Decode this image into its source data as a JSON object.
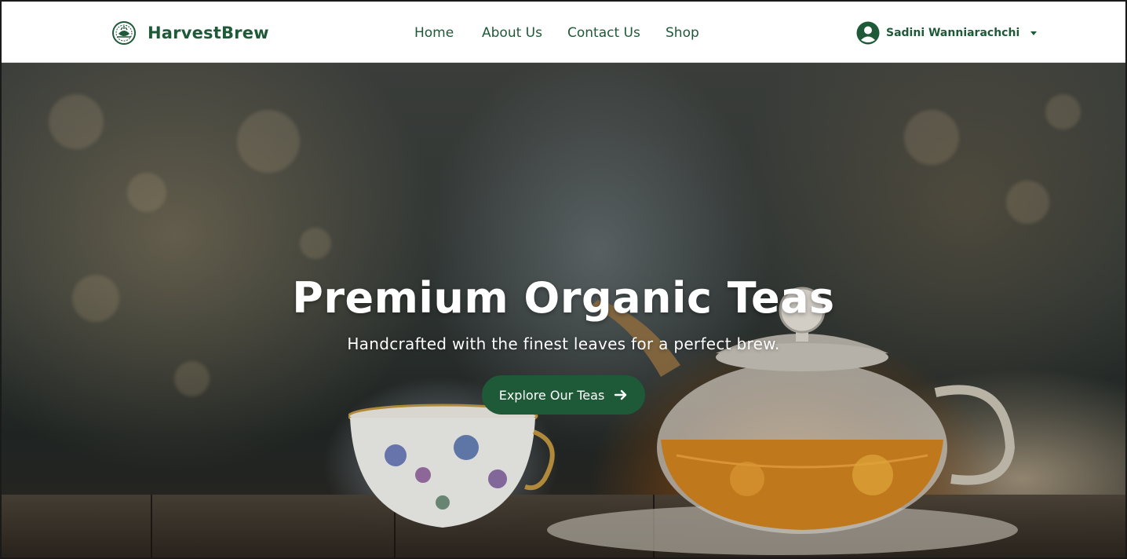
{
  "brand": {
    "name": "HarvestBrew",
    "logo_icon": "tea-emblem-icon"
  },
  "nav": {
    "links": [
      {
        "label": "Home"
      },
      {
        "label": "About Us"
      },
      {
        "label": "Contact Us"
      },
      {
        "label": "Shop"
      }
    ]
  },
  "user": {
    "name": "Sadini Wanniarachchi",
    "avatar_icon": "user-circle-icon",
    "menu_icon": "caret-down-icon"
  },
  "hero": {
    "title": "Premium Organic Teas",
    "subtitle": "Handcrafted with the finest leaves for a perfect brew.",
    "cta_label": "Explore Our Teas",
    "cta_icon": "arrow-right-icon",
    "background": "teapot-and-teacup-photo"
  },
  "colors": {
    "brand_green": "#1e5a38",
    "navbar_bg": "#ffffff",
    "hero_text": "#ffffff"
  }
}
